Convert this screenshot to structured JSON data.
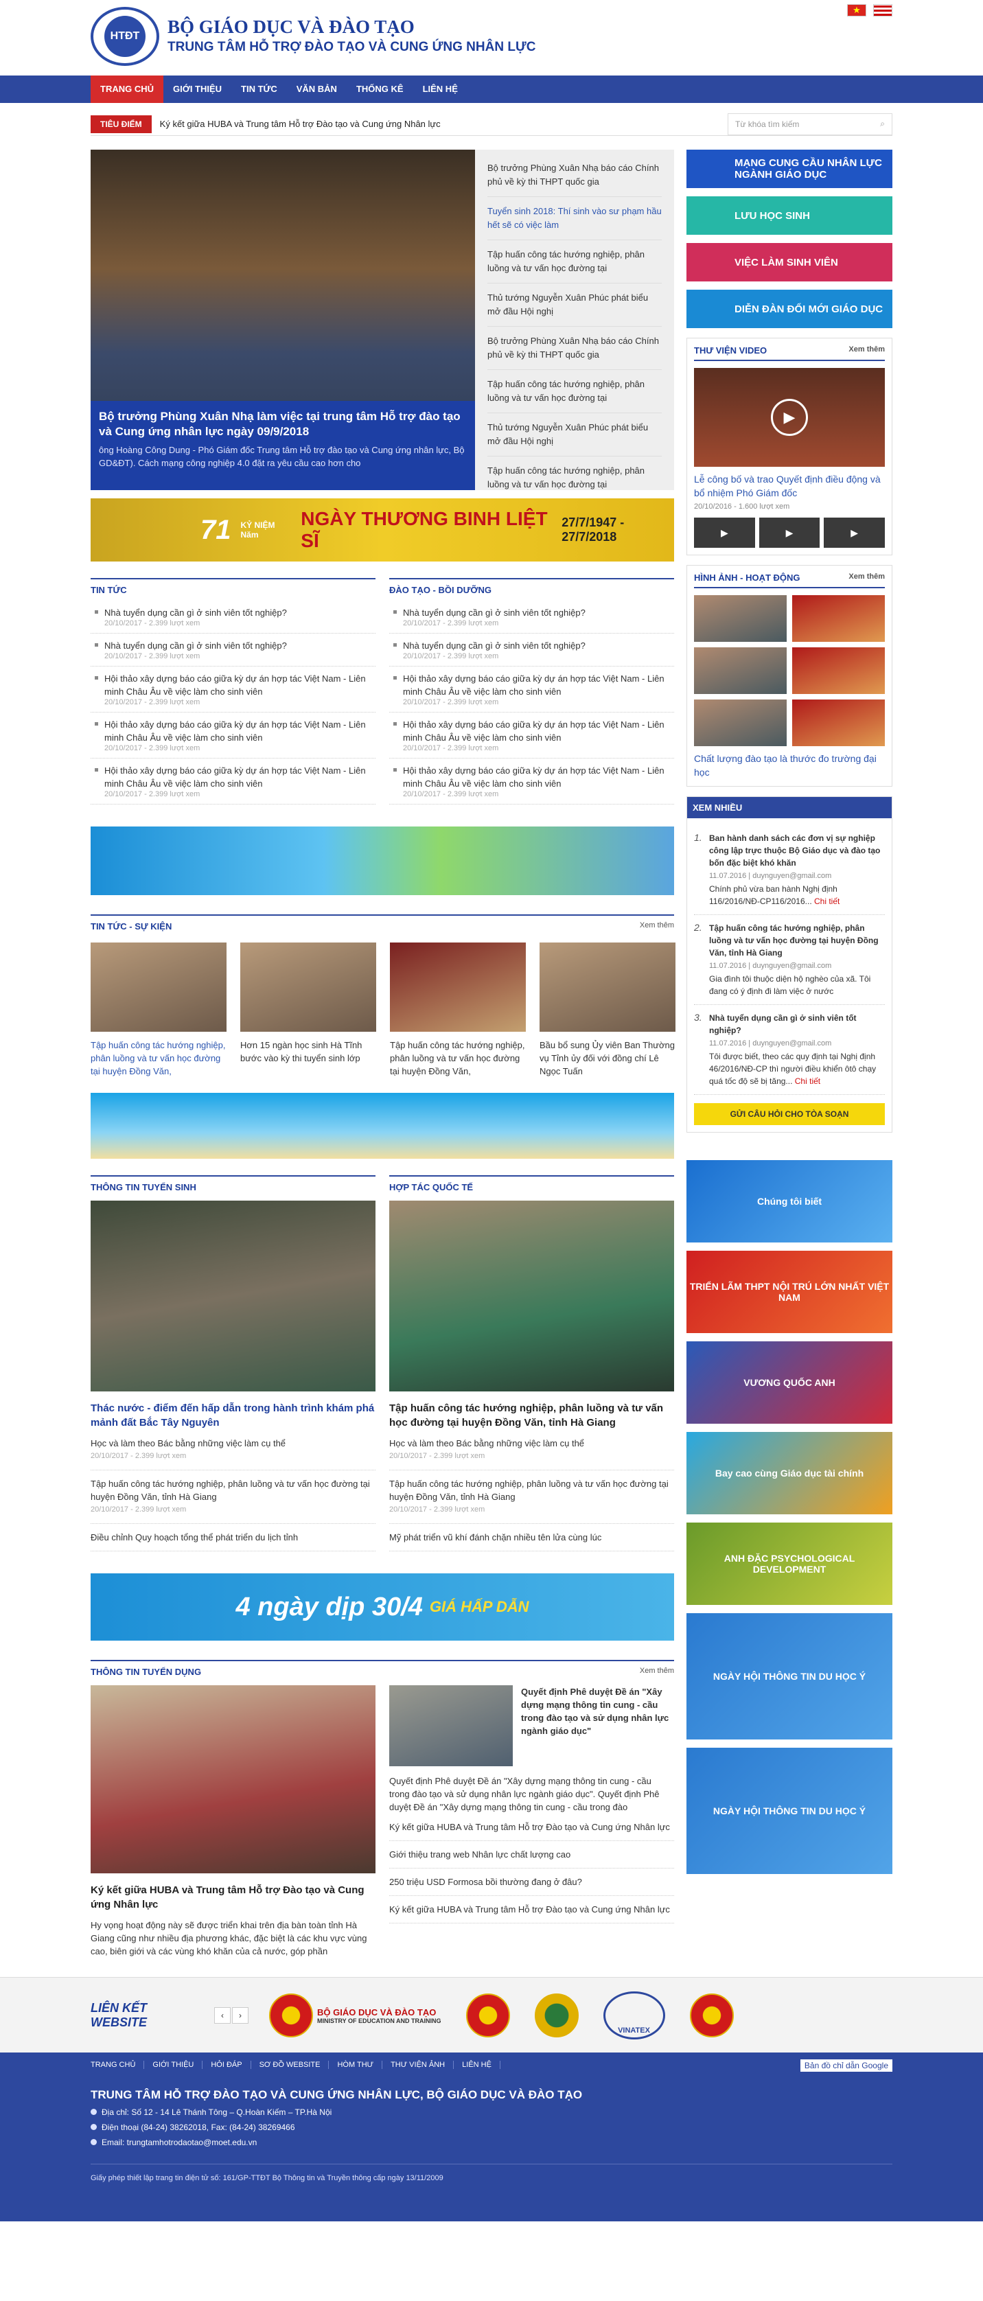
{
  "header": {
    "brand1": "BỘ GIÁO DỤC VÀ ĐÀO TẠO",
    "brand2": "TRUNG TÂM HỖ TRỢ ĐÀO TẠO VÀ CUNG ỨNG NHÂN LỰC",
    "logo": "HTĐT"
  },
  "nav": [
    "TRANG CHỦ",
    "GIỚI THIỆU",
    "TIN TỨC",
    "VĂN BẢN",
    "THỐNG KÊ",
    "LIÊN HỆ"
  ],
  "ticker": {
    "tag": "TIÊU ĐIỂM",
    "text": "Ký kết giữa HUBA và Trung tâm Hỗ trợ Đào tạo và Cung ứng Nhân lực",
    "search_ph": "Từ khóa tìm kiếm"
  },
  "slider": {
    "title": "Bộ trưởng Phùng Xuân Nhạ làm việc tại trung tâm Hỗ trợ đào tạo và Cung ứng nhân lực ngày 09/9/2018",
    "desc": "ông Hoàng Công Dung - Phó Giám đốc Trung tâm Hỗ trợ đào tạo và Cung ứng nhân lực, Bộ GD&ĐT). Cách mạng công nghiệp 4.0 đặt ra yêu cầu cao hơn cho",
    "list": [
      "Bộ trưởng Phùng Xuân Nhạ báo cáo Chính phủ về kỳ thi THPT quốc gia",
      "Tuyển sinh 2018: Thí sinh vào sư phạm hầu hết sẽ có việc làm",
      "Tập huấn công tác hướng nghiệp, phân luồng và tư vấn học đường tại",
      "Thủ tướng Nguyễn Xuân Phúc phát biểu mở đầu Hội nghị",
      "Bộ trưởng Phùng Xuân Nhạ báo cáo Chính phủ về kỳ thi THPT quốc gia",
      "Tập huấn công tác hướng nghiệp, phân luồng và tư vấn học đường tại",
      "Thủ tướng Nguyễn Xuân Phúc phát biểu mở đầu Hội nghị",
      "Tập huấn công tác hướng nghiệp, phân luồng và tư vấn học đường tại"
    ]
  },
  "banner1": {
    "num": "71",
    "small": "KỶ NIỆM Năm",
    "text": "NGÀY THƯƠNG BINH LIỆT SĨ",
    "date": "27/7/1947 - 27/7/2018"
  },
  "tintuc": {
    "title": "TIN TỨC",
    "items": [
      {
        "t": "Nhà tuyển dụng cần gì ở sinh viên tốt nghiệp?",
        "d": "20/10/2017 - 2.399 lượt xem"
      },
      {
        "t": "Nhà tuyển dụng cần gì ở sinh viên tốt nghiệp?",
        "d": "20/10/2017 - 2.399 lượt xem"
      },
      {
        "t": "Hội thảo xây dựng báo cáo giữa kỳ dự án hợp tác Việt Nam - Liên minh Châu Âu về việc làm cho sinh viên",
        "d": "20/10/2017 - 2.399 lượt xem"
      },
      {
        "t": "Hội thảo xây dựng báo cáo giữa kỳ dự án hợp tác Việt Nam - Liên minh Châu Âu về việc làm cho sinh viên",
        "d": "20/10/2017 - 2.399 lượt xem"
      },
      {
        "t": "Hội thảo xây dựng báo cáo giữa kỳ dự án hợp tác Việt Nam - Liên minh Châu Âu về việc làm cho sinh viên",
        "d": "20/10/2017 - 2.399 lượt xem"
      }
    ]
  },
  "daotao": {
    "title": "ĐÀO TẠO - BỒI DƯỠNG"
  },
  "sukien": {
    "title": "TIN TỨC - SỰ KIỆN",
    "more": "Xem thêm",
    "items": [
      "Tập huấn công tác hướng nghiệp, phân luồng và tư vấn học đường tại huyện Đồng Văn,",
      "Hơn 15 ngàn học sinh Hà Tĩnh bước vào kỳ thi tuyển sinh lớp",
      "Tập huấn công tác hướng nghiệp, phân luồng và tư vấn học đường tại huyện Đồng Văn,",
      "Bầu bổ sung Ủy viên Ban Thường vụ Tỉnh ủy đối với đồng chí Lê Ngọc Tuấn"
    ]
  },
  "tuyensinh": {
    "title": "THÔNG TIN TUYỂN SINH",
    "feat": "Thác nước - điểm đến hấp dẫn trong hành trình khám phá mảnh đất Bắc Tây Nguyên",
    "items": [
      {
        "t": "Học và làm theo Bác bằng những việc làm cụ thể",
        "d": "20/10/2017 - 2.399 lượt xem"
      },
      {
        "t": "Tập huấn công tác hướng nghiệp, phân luồng và tư vấn học đường tại huyện Đồng Văn, tỉnh Hà Giang",
        "d": "20/10/2017 - 2.399 lượt xem"
      },
      {
        "t": "Điều chỉnh Quy hoạch tổng thể phát triển du lịch tỉnh",
        "d": ""
      }
    ]
  },
  "hoptac": {
    "title": "HỢP TÁC QUỐC TẾ",
    "feat": "Tập huấn công tác hướng nghiệp, phân luồng và tư vấn học đường tại huyện Đồng Văn, tỉnh Hà Giang",
    "items": [
      {
        "t": "Học và làm theo Bác bằng những việc làm cụ thể",
        "d": "20/10/2017 - 2.399 lượt xem"
      },
      {
        "t": "Tập huấn công tác hướng nghiệp, phân luồng và tư vấn học đường tại huyện Đồng Văn, tỉnh Hà Giang",
        "d": "20/10/2017 - 2.399 lượt xem"
      },
      {
        "t": "Mỹ phát triển vũ khí đánh chặn nhiều tên lửa cùng lúc",
        "d": ""
      }
    ]
  },
  "banner4": {
    "t": "4 ngày dịp 30/4",
    "s": "GIÁ HẤP DẪN"
  },
  "tuyendung": {
    "title": "THÔNG TIN TUYỂN DỤNG",
    "more": "Xem thêm",
    "feat": "Ký kết giữa HUBA và Trung tâm Hỗ trợ Đào tạo và Cung ứng Nhân lực",
    "featdesc": "Hy vọng hoạt động này sẽ được triển khai trên địa bàn toàn tỉnh Hà Giang cũng như nhiều địa phương khác, đặc biệt là các khu vực vùng cao, biên giới và các vùng khó khăn của cả nước, góp phần",
    "side_t": "Quyết định Phê duyệt Đề án \"Xây dựng mạng thông tin cung - cầu trong đào tạo và sử dụng nhân lực ngành giáo dục\"",
    "side_d": "Quyết định Phê duyệt Đề án \"Xây dựng mạng thông tin cung - cầu trong đào tạo và sử dụng nhân lực ngành giáo dục\". Quyết định Phê duyệt Đề án \"Xây dựng mạng thông tin cung - cầu trong đào",
    "list": [
      "Ký kết giữa HUBA và Trung tâm Hỗ trợ Đào tạo và Cung ứng Nhân lực",
      "Giới thiệu trang web Nhân lực chất lượng cao",
      "250 triệu USD Formosa bồi thường đang ở đâu?",
      "Ký kết giữa HUBA và Trung tâm Hỗ trợ Đào tạo và Cung ứng Nhân lực"
    ]
  },
  "widgets": [
    "MẠNG CUNG CẦU NHÂN LỰC NGÀNH GIÁO DỤC",
    "LƯU HỌC SINH",
    "VIỆC LÀM SINH VIÊN",
    "DIỄN ĐÀN ĐỔI MỚI GIÁO DỤC"
  ],
  "video": {
    "title": "THƯ VIỆN VIDEO",
    "more": "Xem thêm",
    "cap": "Lễ công bố và trao Quyết định điều động và bổ nhiệm Phó Giám đốc",
    "meta": "20/10/2016 - 1.600 lượt xem"
  },
  "gallery": {
    "title": "HÌNH ẢNH - HOẠT ĐỘNG",
    "more": "Xem thêm",
    "cap": "Chất lượng đào tạo là thước đo trường đại học"
  },
  "xemnhieu": {
    "title": "XEM NHIỀU",
    "items": [
      {
        "t": "Ban hành danh sách các đơn vị sự nghiệp công lập trực thuộc Bộ Giáo dục và đào tạo bốn đặc biệt khó khăn",
        "m": "11.07.2016 | duynguyen@gmail.com",
        "d": "Chính phủ vừa ban hành Nghị định 116/2016/NĐ-CP116/2016...",
        "c": "Chi tiết"
      },
      {
        "t": "Tập huấn công tác hướng nghiệp, phân luồng và tư vấn học đường tại huyện Đồng Văn, tỉnh Hà Giang",
        "m": "11.07.2016 | duynguyen@gmail.com",
        "d": "Gia đình tôi thuộc diện hộ nghèo của xã. Tôi đang có ý định đi làm việc ở nước",
        "c": ""
      },
      {
        "t": "Nhà tuyển dụng cần gì ở sinh viên tốt nghiệp?",
        "m": "11.07.2016 | duynguyen@gmail.com",
        "d": "Tôi được biết, theo các quy định tại Nghị định 46/2016/NĐ-CP thì người điều khiển ôtô chạy quá tốc độ sẽ bị tăng...",
        "c": "Chi tiết"
      }
    ],
    "ask": "GỬI CÂU HỎI CHO TÒA SOẠN"
  },
  "ads": [
    "Chúng tôi biết",
    "TRIỂN LÃM THPT NỘI TRÚ LỚN NHẤT VIỆT NAM",
    "VƯƠNG QUỐC ANH",
    "Bay cao cùng Giáo dục tài chính",
    "ANH ĐẶC PSYCHOLOGICAL DEVELOPMENT",
    "NGÀY HỘI THÔNG TIN DU HỌC Ý",
    "NGÀY HỘI THÔNG TIN DU HỌC Ý"
  ],
  "links": {
    "title": "LIÊN KẾT WEBSITE",
    "moet": "BỘ GIÁO DỤC VÀ ĐÀO TẠO",
    "moet_en": "MINISTRY OF EDUCATION AND TRAINING",
    "vinatex": "VINATEX"
  },
  "footer": {
    "nav": [
      "TRANG CHỦ",
      "GIỚI THIỆU",
      "HỎI ĐÁP",
      "SƠ ĐỒ WEBSITE",
      "HÒM THƯ",
      "THƯ VIỆN ẢNH",
      "LIÊN HỆ"
    ],
    "gmap": "Bản đồ chỉ dẫn Google",
    "title": "TRUNG TÂM HỖ TRỢ ĐÀO TẠO VÀ CUNG ỨNG NHÂN LỰC, BỘ GIÁO DỤC VÀ ĐÀO TẠO",
    "addr": "Địa chỉ: Số 12 - 14 Lê Thánh Tông – Q.Hoàn Kiếm – TP.Hà Nội",
    "phone": "Điện thoại (84-24) 38262018, Fax: (84-24) 38269466",
    "email": "Email: trungtamhotrodaotao@moet.edu.vn",
    "license": "Giấy phép thiết lập trang tin điện tử số: 161/GP-TTĐT Bộ Thông tin và Truyền thông cấp ngày 13/11/2009"
  }
}
